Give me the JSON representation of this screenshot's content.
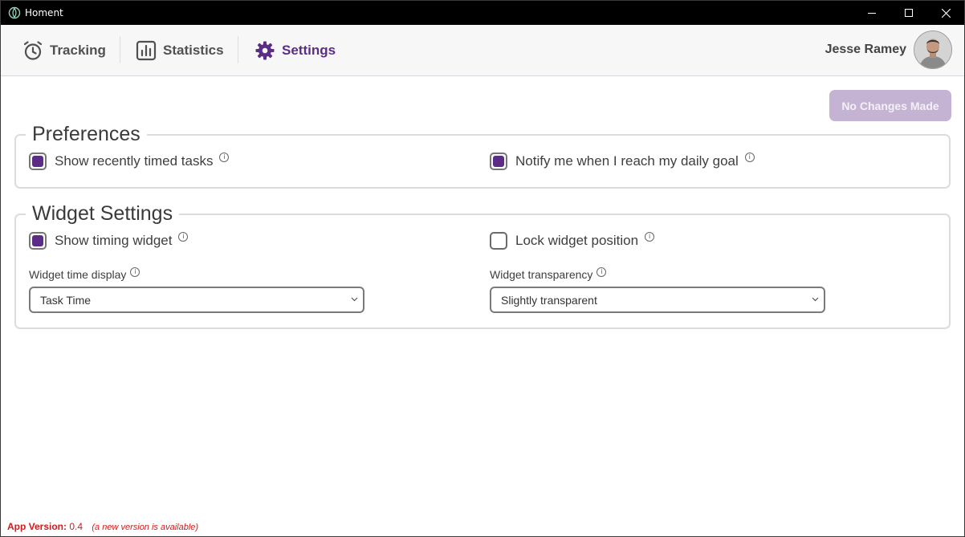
{
  "window": {
    "title": "Homent",
    "controls": {
      "minimize": "minimize-icon",
      "maximize": "maximize-icon",
      "close": "close-icon"
    }
  },
  "nav": {
    "tabs": [
      {
        "label": "Tracking",
        "icon": "stopwatch-icon",
        "active": false
      },
      {
        "label": "Statistics",
        "icon": "bar-chart-icon",
        "active": false
      },
      {
        "label": "Settings",
        "icon": "gear-icon",
        "active": true
      }
    ],
    "user_name": "Jesse Ramey"
  },
  "actions": {
    "save_label": "No Changes Made"
  },
  "preferences": {
    "title": "Preferences",
    "show_recent_label": "Show recently timed tasks",
    "show_recent_checked": true,
    "notify_goal_label": "Notify me when I reach my daily goal",
    "notify_goal_checked": true
  },
  "widget": {
    "title": "Widget Settings",
    "show_widget_label": "Show timing widget",
    "show_widget_checked": true,
    "lock_position_label": "Lock widget position",
    "lock_position_checked": false,
    "time_display_label": "Widget time display",
    "time_display_value": "Task Time",
    "transparency_label": "Widget transparency",
    "transparency_value": "Slightly transparent"
  },
  "footer": {
    "version_key": "App Version:",
    "version_value": "0.4",
    "update_note": "(a new version is available)"
  },
  "colors": {
    "accent": "#5c2d86",
    "disabled_button": "#c4b3d3",
    "warning": "#d01c1c"
  }
}
